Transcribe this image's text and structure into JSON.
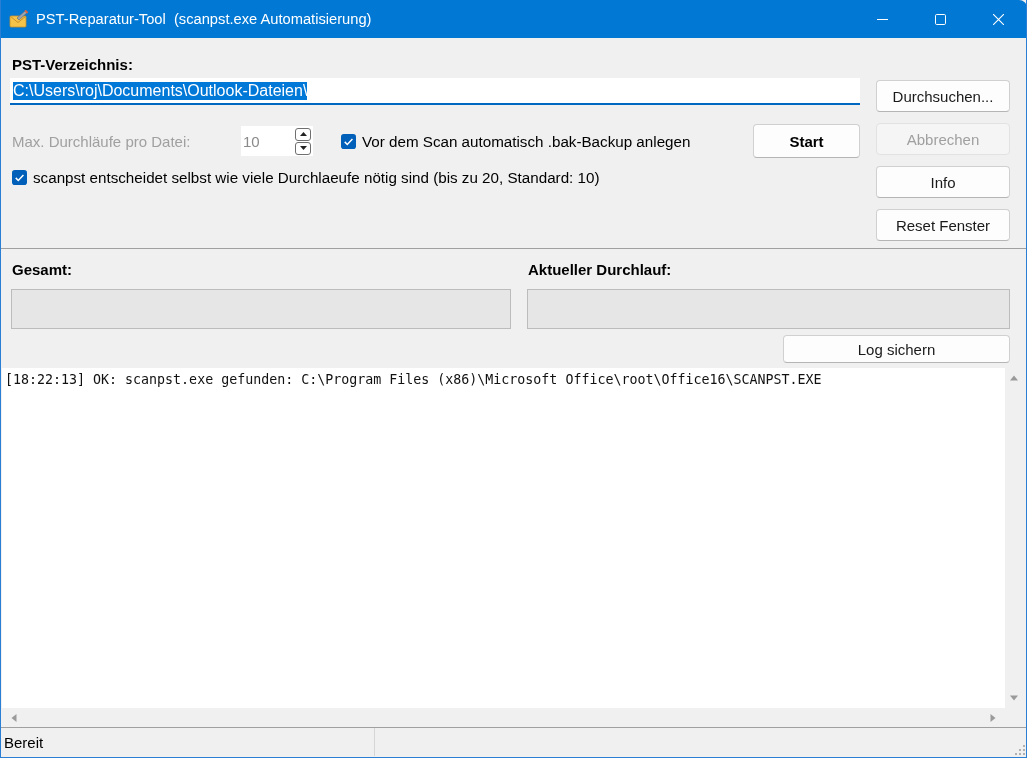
{
  "window": {
    "title": "PST-Reparatur-Tool  (scanpst.exe Automatisierung)"
  },
  "directory": {
    "label": "PST-Verzeichnis:",
    "value": "C:\\Users\\roj\\Documents\\Outlook-Dateien\\",
    "selected": true,
    "focused": true
  },
  "passes": {
    "label": "Max. Durchläufe pro Datei:",
    "value": "10",
    "disabled": true
  },
  "options": [
    {
      "label": "Vor dem Scan automatisch .bak-Backup anlegen",
      "checked": true
    },
    {
      "label": "scanpst entscheidet selbst wie viele Durchlaeufe nötig sind (bis zu 20, Standard: 10)",
      "checked": true
    }
  ],
  "start_button": {
    "label": "Start",
    "default": true,
    "disabled": false
  },
  "side_buttons": [
    {
      "label": "Durchsuchen...",
      "default": false,
      "disabled": false
    },
    {
      "label": "Abbrechen",
      "default": false,
      "disabled": true
    },
    {
      "label": "Info",
      "default": false,
      "disabled": false
    },
    {
      "label": "Reset Fenster",
      "default": false,
      "disabled": false
    }
  ],
  "progress": [
    {
      "label": "Gesamt:",
      "level": 0
    },
    {
      "label": "Aktueller Durchlauf:",
      "level": 0
    }
  ],
  "log": {
    "button": "Log sichern",
    "lines": [
      "[18:22:13] OK: scanpst.exe gefunden: C:\\Program Files (x86)\\Microsoft Office\\root\\Office16\\SCANPST.EXE"
    ]
  },
  "status_bar": {
    "text": "Bereit"
  }
}
